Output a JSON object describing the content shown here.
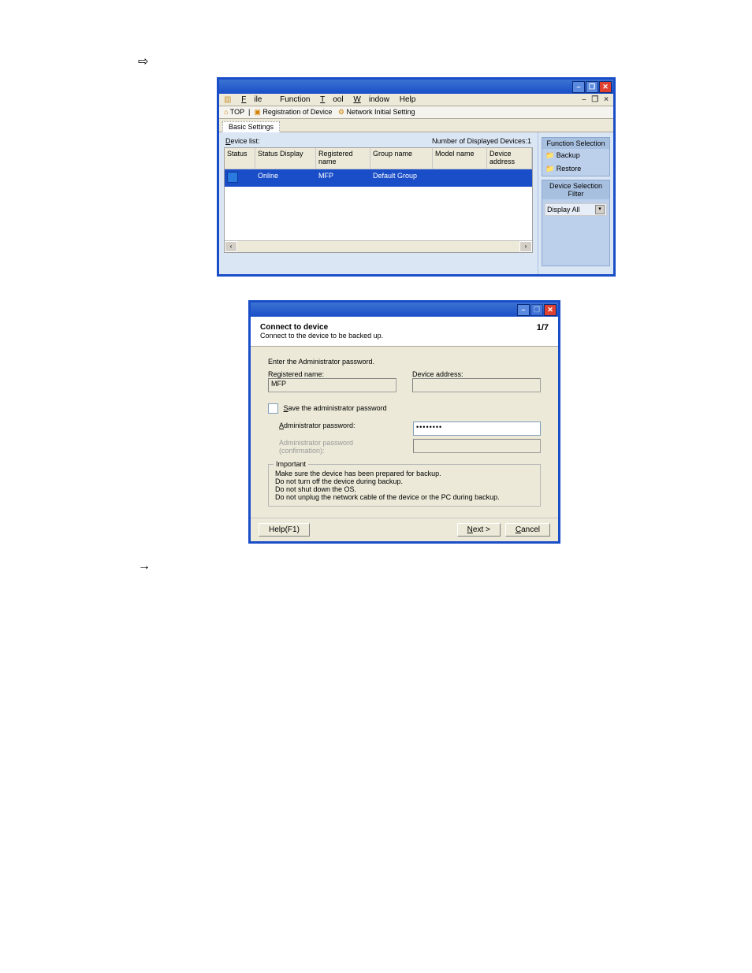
{
  "arrows": {
    "right_thick": "⇨",
    "right_thin": "→"
  },
  "win1": {
    "menu": [
      "File",
      "Function",
      "Tool",
      "Window",
      "Help"
    ],
    "mdi": [
      "–",
      "❐",
      "×"
    ],
    "toolbar": {
      "top": "TOP",
      "reg": "Registration of Device",
      "net": "Network Initial Setting"
    },
    "tab": "Basic Settings",
    "list_label": "Device list:",
    "count_label": "Number of Displayed Devices:1",
    "headers": [
      "Status",
      "Status Display",
      "Registered name",
      "Group name",
      "Model name",
      "Device address"
    ],
    "row": {
      "status_display": "Online",
      "reg_name": "MFP",
      "group": "Default Group",
      "model": "",
      "addr": ""
    },
    "sidebar": {
      "func_title": "Function Selection",
      "backup": "Backup",
      "restore": "Restore",
      "filter_title": "Device Selection Filter",
      "filter_value": "Display All"
    },
    "titlebtns": [
      "–",
      "❐",
      "✕"
    ]
  },
  "dlg": {
    "titlebtns": [
      "–",
      "❐",
      "✕"
    ],
    "title": "Connect to device",
    "subtitle": "Connect to the device to be backed up.",
    "step": "1/7",
    "enter_pw": "Enter the Administrator password.",
    "reg_label": "Registered name:",
    "reg_value": "MFP",
    "addr_label": "Device address:",
    "save_pw": "Save the administrator password",
    "pw_label": "Administrator password:",
    "pw_value": "••••••••",
    "pwc_label": "Administrator password (confirmation):",
    "important": "Important",
    "imp1": "Make sure the device has been prepared for backup.",
    "imp2": "Do not turn off the device during backup.",
    "imp3": "Do not shut down the OS.",
    "imp4": "Do not unplug the network cable of the device or the PC during backup.",
    "help": "Help(F1)",
    "next": "Next >",
    "cancel": "Cancel"
  }
}
